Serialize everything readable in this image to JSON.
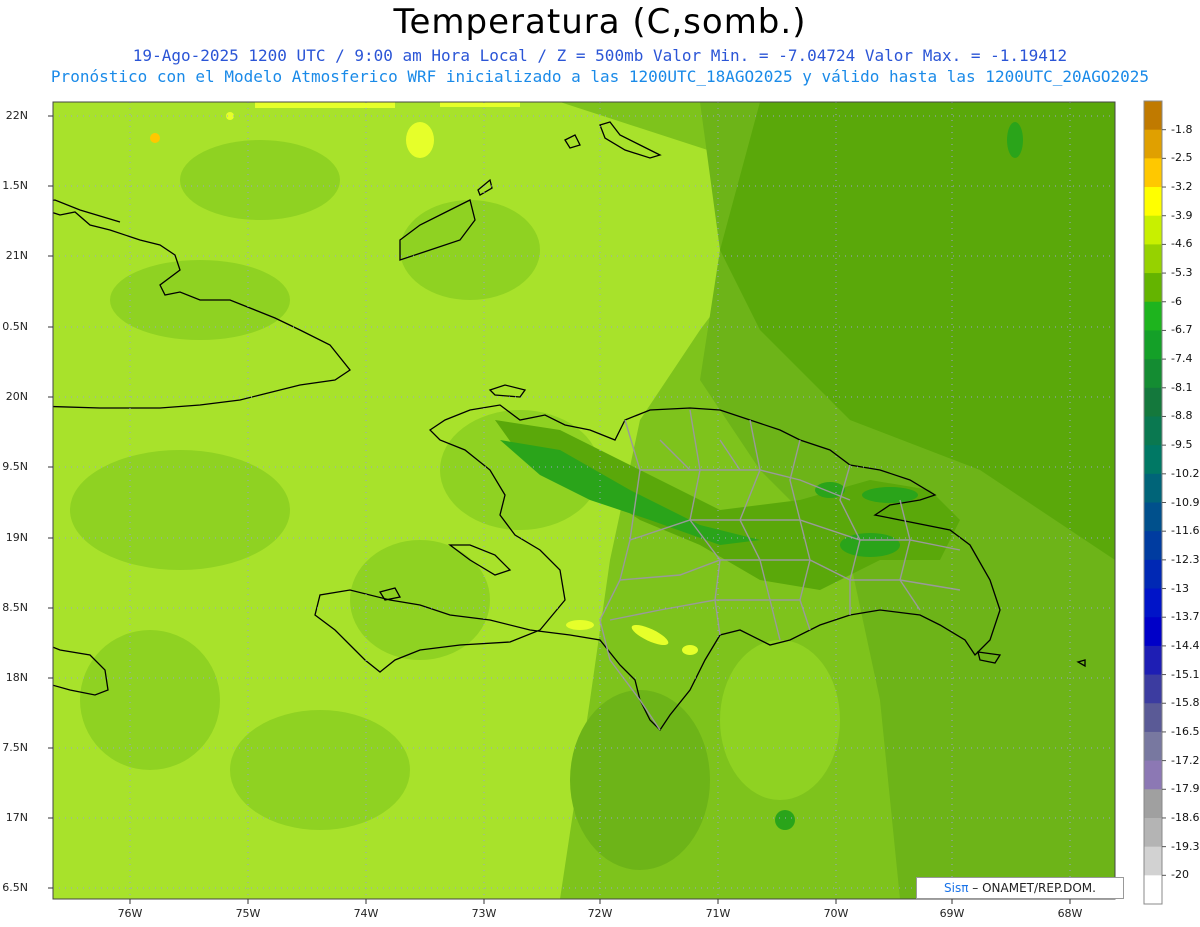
{
  "header": {
    "title": "Temperatura (C,somb.)",
    "subtitle_1": "19-Ago-2025  1200 UTC / 9:00 am Hora Local / Z = 500mb  Valor Min. = -7.04724  Valor Max. = -1.19412",
    "subtitle_2": "Pronóstico con el Modelo Atmosferico WRF inicializado a las 1200UTC_18AGO2025 y válido hasta las  1200UTC_20AGO2025"
  },
  "map": {
    "lat_labels": [
      "22N",
      "1.5N",
      "21N",
      "0.5N",
      "20N",
      "9.5N",
      "19N",
      "8.5N",
      "18N",
      "7.5N",
      "17N",
      "6.5N"
    ],
    "lon_labels": [
      "76W",
      "75W",
      "74W",
      "73W",
      "72W",
      "71W",
      "70W",
      "69W",
      "68W"
    ],
    "credit_prefix": "Sis",
    "credit_pi": "π",
    "credit_suffix": "– ONAMET/REP.DOM."
  },
  "colorbar": {
    "labels": [
      "-1.8",
      "-2.5",
      "-3.2",
      "-3.9",
      "-4.6",
      "-5.3",
      "-6",
      "-6.7",
      "-7.4",
      "-8.1",
      "-8.8",
      "-9.5",
      "-10.2",
      "-10.9",
      "-11.6",
      "-12.3",
      "-13",
      "-13.7",
      "-14.4",
      "-15.1",
      "-15.8",
      "-16.5",
      "-17.2",
      "-17.9",
      "-18.6",
      "-19.3",
      "-20"
    ],
    "colors": [
      "#c07a00",
      "#e0a000",
      "#ffc800",
      "#ffff00",
      "#c8f000",
      "#96d200",
      "#64b400",
      "#1eb41e",
      "#14a028",
      "#148c32",
      "#14783c",
      "#0a7850",
      "#007864",
      "#006478",
      "#00508c",
      "#003ca0",
      "#0028b4",
      "#0014c8",
      "#0000c8",
      "#1e1eb4",
      "#3c3ca0",
      "#5a5a96",
      "#7878a0",
      "#8c78b4",
      "#a0a0a0",
      "#b4b4b4",
      "#d2d2d2",
      "#ffffff"
    ]
  },
  "colors": {
    "background_field": "#a8e22b",
    "mid_green": "#7ec31c",
    "dark_green": "#5aa80a",
    "deep_green": "#2aa41a"
  }
}
